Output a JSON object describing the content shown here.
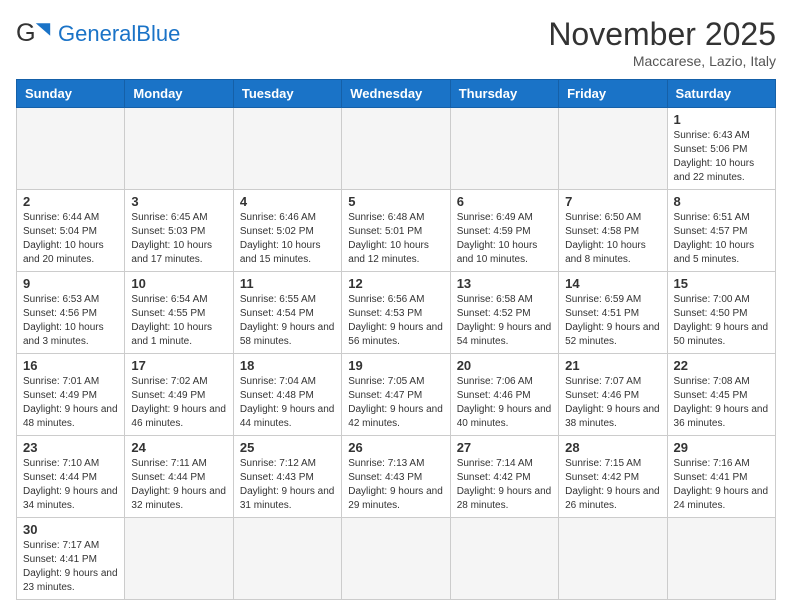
{
  "header": {
    "logo_general": "General",
    "logo_blue": "Blue",
    "month_title": "November 2025",
    "location": "Maccarese, Lazio, Italy"
  },
  "days_of_week": [
    "Sunday",
    "Monday",
    "Tuesday",
    "Wednesday",
    "Thursday",
    "Friday",
    "Saturday"
  ],
  "weeks": [
    [
      {
        "day": "",
        "info": ""
      },
      {
        "day": "",
        "info": ""
      },
      {
        "day": "",
        "info": ""
      },
      {
        "day": "",
        "info": ""
      },
      {
        "day": "",
        "info": ""
      },
      {
        "day": "",
        "info": ""
      },
      {
        "day": "1",
        "info": "Sunrise: 6:43 AM\nSunset: 5:06 PM\nDaylight: 10 hours\nand 22 minutes."
      }
    ],
    [
      {
        "day": "2",
        "info": "Sunrise: 6:44 AM\nSunset: 5:04 PM\nDaylight: 10 hours\nand 20 minutes."
      },
      {
        "day": "3",
        "info": "Sunrise: 6:45 AM\nSunset: 5:03 PM\nDaylight: 10 hours\nand 17 minutes."
      },
      {
        "day": "4",
        "info": "Sunrise: 6:46 AM\nSunset: 5:02 PM\nDaylight: 10 hours\nand 15 minutes."
      },
      {
        "day": "5",
        "info": "Sunrise: 6:48 AM\nSunset: 5:01 PM\nDaylight: 10 hours\nand 12 minutes."
      },
      {
        "day": "6",
        "info": "Sunrise: 6:49 AM\nSunset: 4:59 PM\nDaylight: 10 hours\nand 10 minutes."
      },
      {
        "day": "7",
        "info": "Sunrise: 6:50 AM\nSunset: 4:58 PM\nDaylight: 10 hours\nand 8 minutes."
      },
      {
        "day": "8",
        "info": "Sunrise: 6:51 AM\nSunset: 4:57 PM\nDaylight: 10 hours\nand 5 minutes."
      }
    ],
    [
      {
        "day": "9",
        "info": "Sunrise: 6:53 AM\nSunset: 4:56 PM\nDaylight: 10 hours\nand 3 minutes."
      },
      {
        "day": "10",
        "info": "Sunrise: 6:54 AM\nSunset: 4:55 PM\nDaylight: 10 hours\nand 1 minute."
      },
      {
        "day": "11",
        "info": "Sunrise: 6:55 AM\nSunset: 4:54 PM\nDaylight: 9 hours\nand 58 minutes."
      },
      {
        "day": "12",
        "info": "Sunrise: 6:56 AM\nSunset: 4:53 PM\nDaylight: 9 hours\nand 56 minutes."
      },
      {
        "day": "13",
        "info": "Sunrise: 6:58 AM\nSunset: 4:52 PM\nDaylight: 9 hours\nand 54 minutes."
      },
      {
        "day": "14",
        "info": "Sunrise: 6:59 AM\nSunset: 4:51 PM\nDaylight: 9 hours\nand 52 minutes."
      },
      {
        "day": "15",
        "info": "Sunrise: 7:00 AM\nSunset: 4:50 PM\nDaylight: 9 hours\nand 50 minutes."
      }
    ],
    [
      {
        "day": "16",
        "info": "Sunrise: 7:01 AM\nSunset: 4:49 PM\nDaylight: 9 hours\nand 48 minutes."
      },
      {
        "day": "17",
        "info": "Sunrise: 7:02 AM\nSunset: 4:49 PM\nDaylight: 9 hours\nand 46 minutes."
      },
      {
        "day": "18",
        "info": "Sunrise: 7:04 AM\nSunset: 4:48 PM\nDaylight: 9 hours\nand 44 minutes."
      },
      {
        "day": "19",
        "info": "Sunrise: 7:05 AM\nSunset: 4:47 PM\nDaylight: 9 hours\nand 42 minutes."
      },
      {
        "day": "20",
        "info": "Sunrise: 7:06 AM\nSunset: 4:46 PM\nDaylight: 9 hours\nand 40 minutes."
      },
      {
        "day": "21",
        "info": "Sunrise: 7:07 AM\nSunset: 4:46 PM\nDaylight: 9 hours\nand 38 minutes."
      },
      {
        "day": "22",
        "info": "Sunrise: 7:08 AM\nSunset: 4:45 PM\nDaylight: 9 hours\nand 36 minutes."
      }
    ],
    [
      {
        "day": "23",
        "info": "Sunrise: 7:10 AM\nSunset: 4:44 PM\nDaylight: 9 hours\nand 34 minutes."
      },
      {
        "day": "24",
        "info": "Sunrise: 7:11 AM\nSunset: 4:44 PM\nDaylight: 9 hours\nand 32 minutes."
      },
      {
        "day": "25",
        "info": "Sunrise: 7:12 AM\nSunset: 4:43 PM\nDaylight: 9 hours\nand 31 minutes."
      },
      {
        "day": "26",
        "info": "Sunrise: 7:13 AM\nSunset: 4:43 PM\nDaylight: 9 hours\nand 29 minutes."
      },
      {
        "day": "27",
        "info": "Sunrise: 7:14 AM\nSunset: 4:42 PM\nDaylight: 9 hours\nand 28 minutes."
      },
      {
        "day": "28",
        "info": "Sunrise: 7:15 AM\nSunset: 4:42 PM\nDaylight: 9 hours\nand 26 minutes."
      },
      {
        "day": "29",
        "info": "Sunrise: 7:16 AM\nSunset: 4:41 PM\nDaylight: 9 hours\nand 24 minutes."
      }
    ],
    [
      {
        "day": "30",
        "info": "Sunrise: 7:17 AM\nSunset: 4:41 PM\nDaylight: 9 hours\nand 23 minutes."
      },
      {
        "day": "",
        "info": ""
      },
      {
        "day": "",
        "info": ""
      },
      {
        "day": "",
        "info": ""
      },
      {
        "day": "",
        "info": ""
      },
      {
        "day": "",
        "info": ""
      },
      {
        "day": "",
        "info": ""
      }
    ]
  ]
}
